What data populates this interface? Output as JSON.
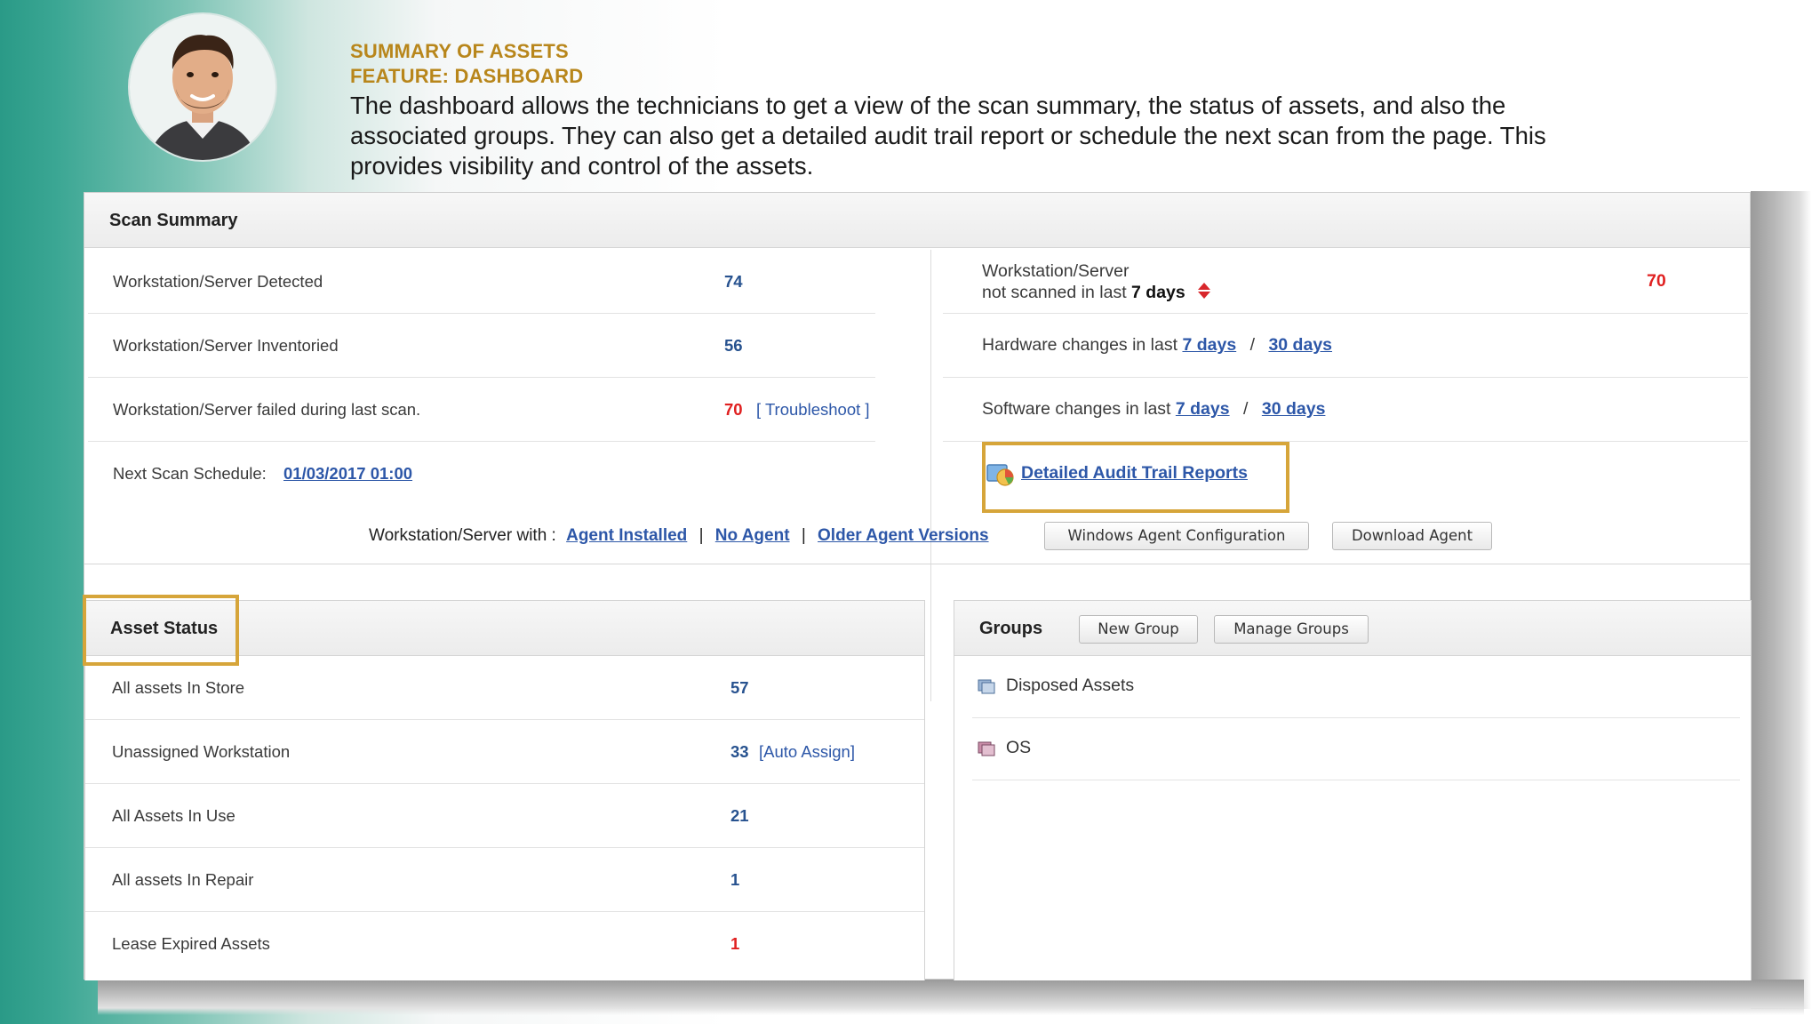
{
  "caption": {
    "heading1": "SUMMARY OF ASSETS",
    "heading2": "FEATURE: DASHBOARD",
    "description": "The dashboard allows the technicians to get a view of the scan summary, the status of assets, and also the associated groups. They can also get a detailed audit trail report or schedule the next scan from the page. This provides visibility and control of the assets."
  },
  "scan_summary": {
    "title": "Scan Summary",
    "left_rows": [
      {
        "label": "Workstation/Server Detected",
        "value": "74"
      },
      {
        "label": "Workstation/Server Inventoried",
        "value": "56"
      },
      {
        "label": "Workstation/Server failed during last scan.",
        "value": "70",
        "action": "[ Troubleshoot ]"
      }
    ],
    "next_scan": {
      "label": "Next Scan Schedule:",
      "value": "01/03/2017 01:00"
    },
    "not_scanned": {
      "line1": "Workstation/Server",
      "line2_prefix": "not scanned in last",
      "line2_days": "7 days",
      "value": "70"
    },
    "hardware": {
      "label": "Hardware changes in last",
      "link1": "7 days",
      "sep": "/",
      "link2": "30 days"
    },
    "software": {
      "label": "Software changes in last",
      "link1": "7 days",
      "sep": "/",
      "link2": "30 days"
    },
    "audit_link": "Detailed Audit Trail Reports"
  },
  "agent_bar": {
    "label": "Workstation/Server with :",
    "links": [
      "Agent Installed",
      "No Agent",
      "Older Agent Versions"
    ],
    "separator": "|",
    "buttons": [
      "Windows Agent Configuration",
      "Download Agent"
    ]
  },
  "asset_status": {
    "title": "Asset Status",
    "rows": [
      {
        "label": "All assets In Store",
        "value": "57"
      },
      {
        "label": "Unassigned Workstation",
        "value": "33",
        "action": "[Auto Assign]"
      },
      {
        "label": "All Assets In Use",
        "value": "21"
      },
      {
        "label": "All assets In Repair",
        "value": "1"
      },
      {
        "label": "Lease Expired Assets",
        "value": "1"
      }
    ]
  },
  "groups": {
    "title": "Groups",
    "buttons": [
      "New Group",
      "Manage Groups"
    ],
    "items": [
      {
        "label": "Disposed Assets",
        "icon": "group-icon"
      },
      {
        "label": "OS",
        "icon": "group-icon"
      }
    ]
  },
  "colors": {
    "accent_gold": "#b8861b",
    "highlight_box": "#d6a53a",
    "link_blue": "#2d57a8",
    "value_blue": "#27528f",
    "alert_red": "#e02020"
  }
}
